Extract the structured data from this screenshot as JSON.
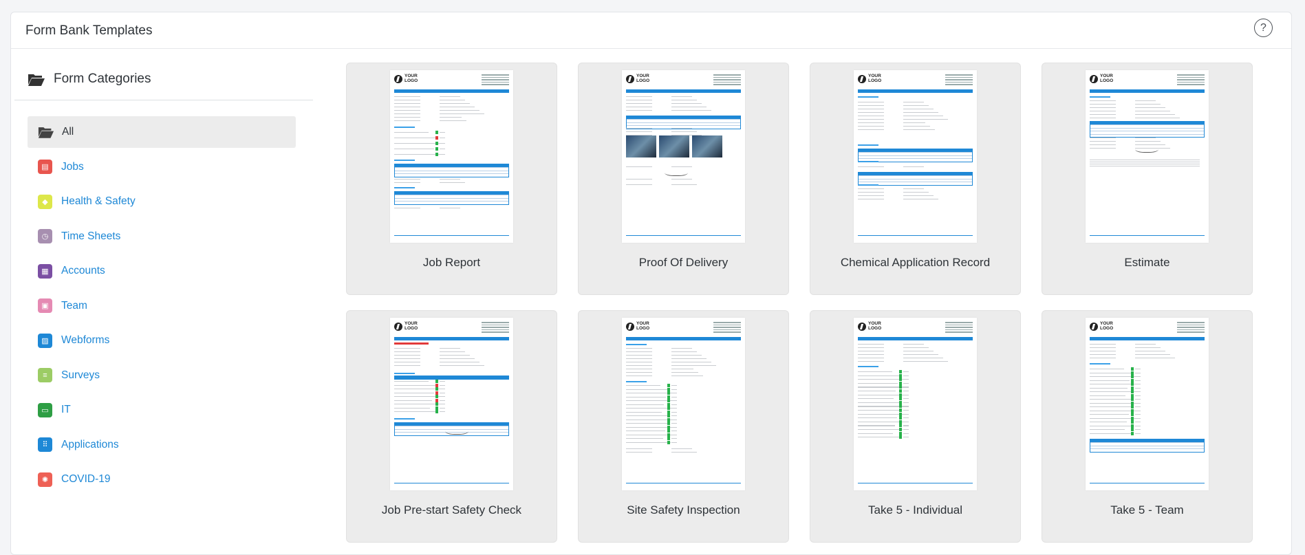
{
  "header": {
    "title": "Form Bank Templates",
    "help_label": "?"
  },
  "sidebar": {
    "title": "Form Categories",
    "items": [
      {
        "label": "All",
        "icon": "folder-open-icon",
        "color": "#444444",
        "active": true
      },
      {
        "label": "Jobs",
        "icon": "briefcase-icon",
        "color": "#e8554e"
      },
      {
        "label": "Health & Safety",
        "icon": "shield-icon",
        "color": "#dde74a"
      },
      {
        "label": "Time Sheets",
        "icon": "clock-icon",
        "color": "#a78fb0"
      },
      {
        "label": "Accounts",
        "icon": "calculator-icon",
        "color": "#7b4fa3"
      },
      {
        "label": "Team",
        "icon": "id-card-icon",
        "color": "#e58ab3"
      },
      {
        "label": "Webforms",
        "icon": "web-form-icon",
        "color": "#1e88d6"
      },
      {
        "label": "Surveys",
        "icon": "survey-icon",
        "color": "#9ccc65"
      },
      {
        "label": "IT",
        "icon": "laptop-icon",
        "color": "#2e9e44"
      },
      {
        "label": "Applications",
        "icon": "grid-icon",
        "color": "#1e88d6"
      },
      {
        "label": "COVID-19",
        "icon": "virus-icon",
        "color": "#ee6055"
      }
    ]
  },
  "cards": [
    {
      "label": "Job Report",
      "layout": "job-report"
    },
    {
      "label": "Proof Of Delivery",
      "layout": "delivery"
    },
    {
      "label": "Chemical Application Record",
      "layout": "chemical"
    },
    {
      "label": "Estimate",
      "layout": "estimate"
    },
    {
      "label": "Job Pre-start Safety Check",
      "layout": "prestart"
    },
    {
      "label": "Site Safety Inspection",
      "layout": "inspection"
    },
    {
      "label": "Take 5 - Individual",
      "layout": "take5"
    },
    {
      "label": "Take 5 - Team",
      "layout": "take5team"
    }
  ],
  "thumb_text": {
    "logo_line1": "YOUR",
    "logo_line2": "LOGO"
  }
}
